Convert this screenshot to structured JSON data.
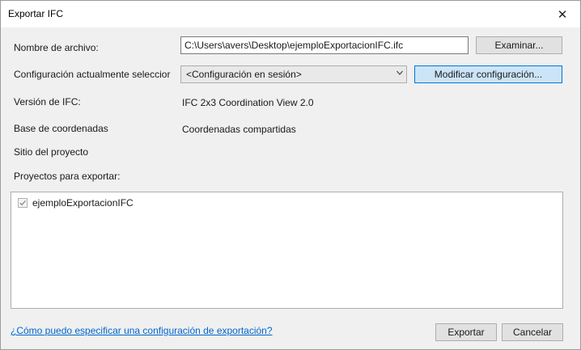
{
  "window": {
    "title": "Exportar IFC",
    "close_symbol": "✕"
  },
  "form": {
    "filename_label": "Nombre de archivo:",
    "filename_value": "C:\\Users\\avers\\Desktop\\ejemploExportacionIFC.ifc",
    "browse_button": "Examinar...",
    "config_label": "Configuración actualmente seleccior",
    "config_selected": "<Configuración en sesión>",
    "modify_config_button": "Modificar configuración...",
    "ifc_version_label": "Versión de IFC:",
    "ifc_version_value": "IFC 2x3 Coordination View 2.0",
    "coord_base_label": "Base de coordenadas",
    "coord_base_value": "Coordenadas compartidas",
    "project_site_label": "Sitio del proyecto",
    "projects_label": "Proyectos para exportar:"
  },
  "projects": {
    "items": [
      {
        "name": "ejemploExportacionIFC",
        "checked": true
      }
    ]
  },
  "footer": {
    "help_link": "¿Cómo puedo especificar una configuración de exportación?",
    "export_button": "Exportar",
    "cancel_button": "Cancelar"
  },
  "colors": {
    "primary_button_bg": "#cce4f7",
    "primary_button_border": "#0078d7",
    "link": "#0066cc"
  },
  "icons": {
    "close": "close-icon",
    "dropdown": "chevron-down-icon",
    "check": "checkmark-icon"
  }
}
